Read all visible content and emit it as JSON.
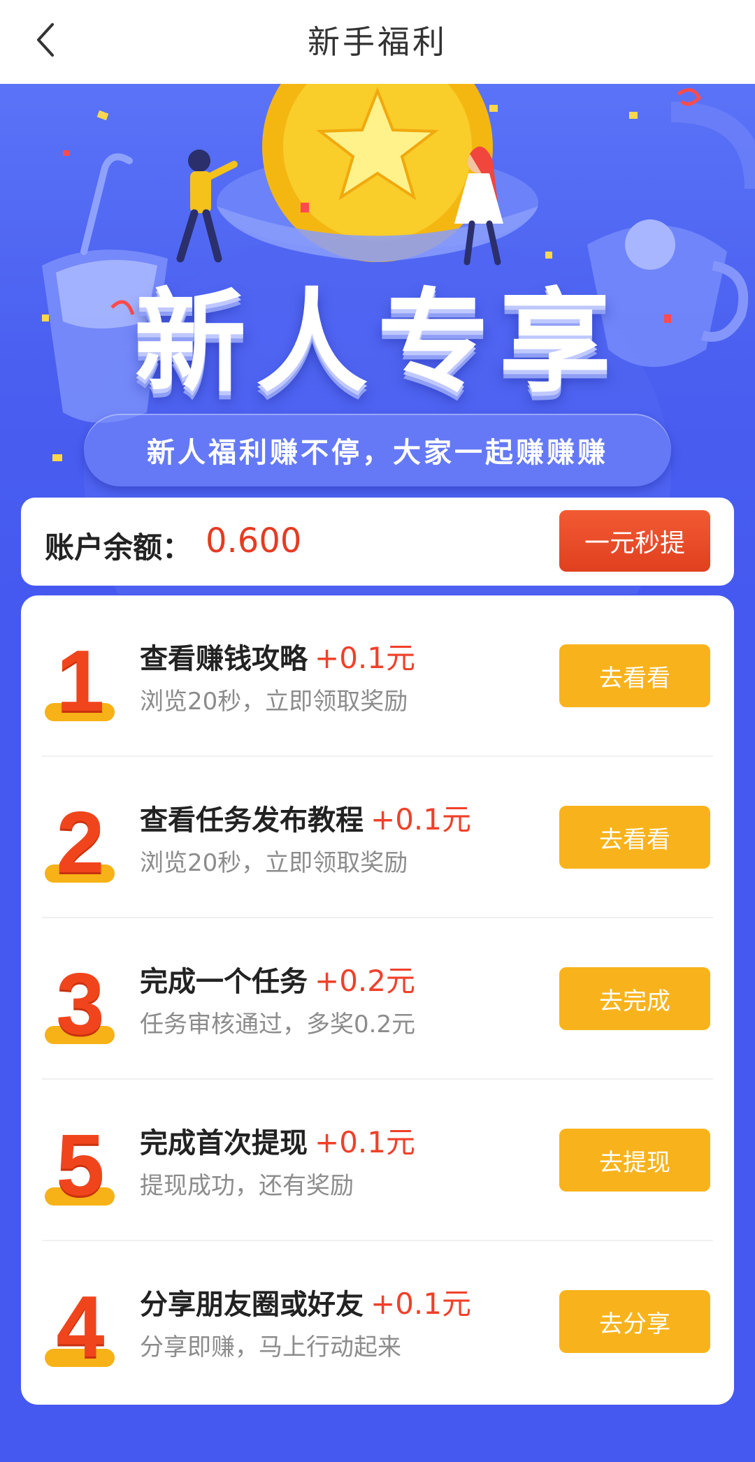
{
  "header": {
    "title": "新手福利"
  },
  "banner": {
    "title": "新人专享",
    "subtitle": "新人福利赚不停，大家一起赚赚赚"
  },
  "balance": {
    "label": "账户余额：",
    "value": "0.600",
    "withdraw_label": "一元秒提"
  },
  "tasks": [
    {
      "rank": "1",
      "title": "查看赚钱攻略",
      "reward": "+0.1元",
      "desc": "浏览20秒，立即领取奖励",
      "button": "去看看"
    },
    {
      "rank": "2",
      "title": "查看任务发布教程",
      "reward": "+0.1元",
      "desc": "浏览20秒，立即领取奖励",
      "button": "去看看"
    },
    {
      "rank": "3",
      "title": "完成一个任务",
      "reward": "+0.2元",
      "desc": "任务审核通过，多奖0.2元",
      "button": "去完成"
    },
    {
      "rank": "5",
      "title": "完成首次提现",
      "reward": "+0.1元",
      "desc": "提现成功，还有奖励",
      "button": "去提现"
    },
    {
      "rank": "4",
      "title": "分享朋友圈或好友",
      "reward": "+0.1元",
      "desc": "分享即赚，马上行动起来",
      "button": "去分享"
    }
  ],
  "colors": {
    "accent_red": "#e53b22",
    "button_yellow": "#f8b31c",
    "page_blue": "#4559f0"
  },
  "icons": {
    "back": "back-chevron-icon",
    "coin": "star-coin-icon"
  }
}
